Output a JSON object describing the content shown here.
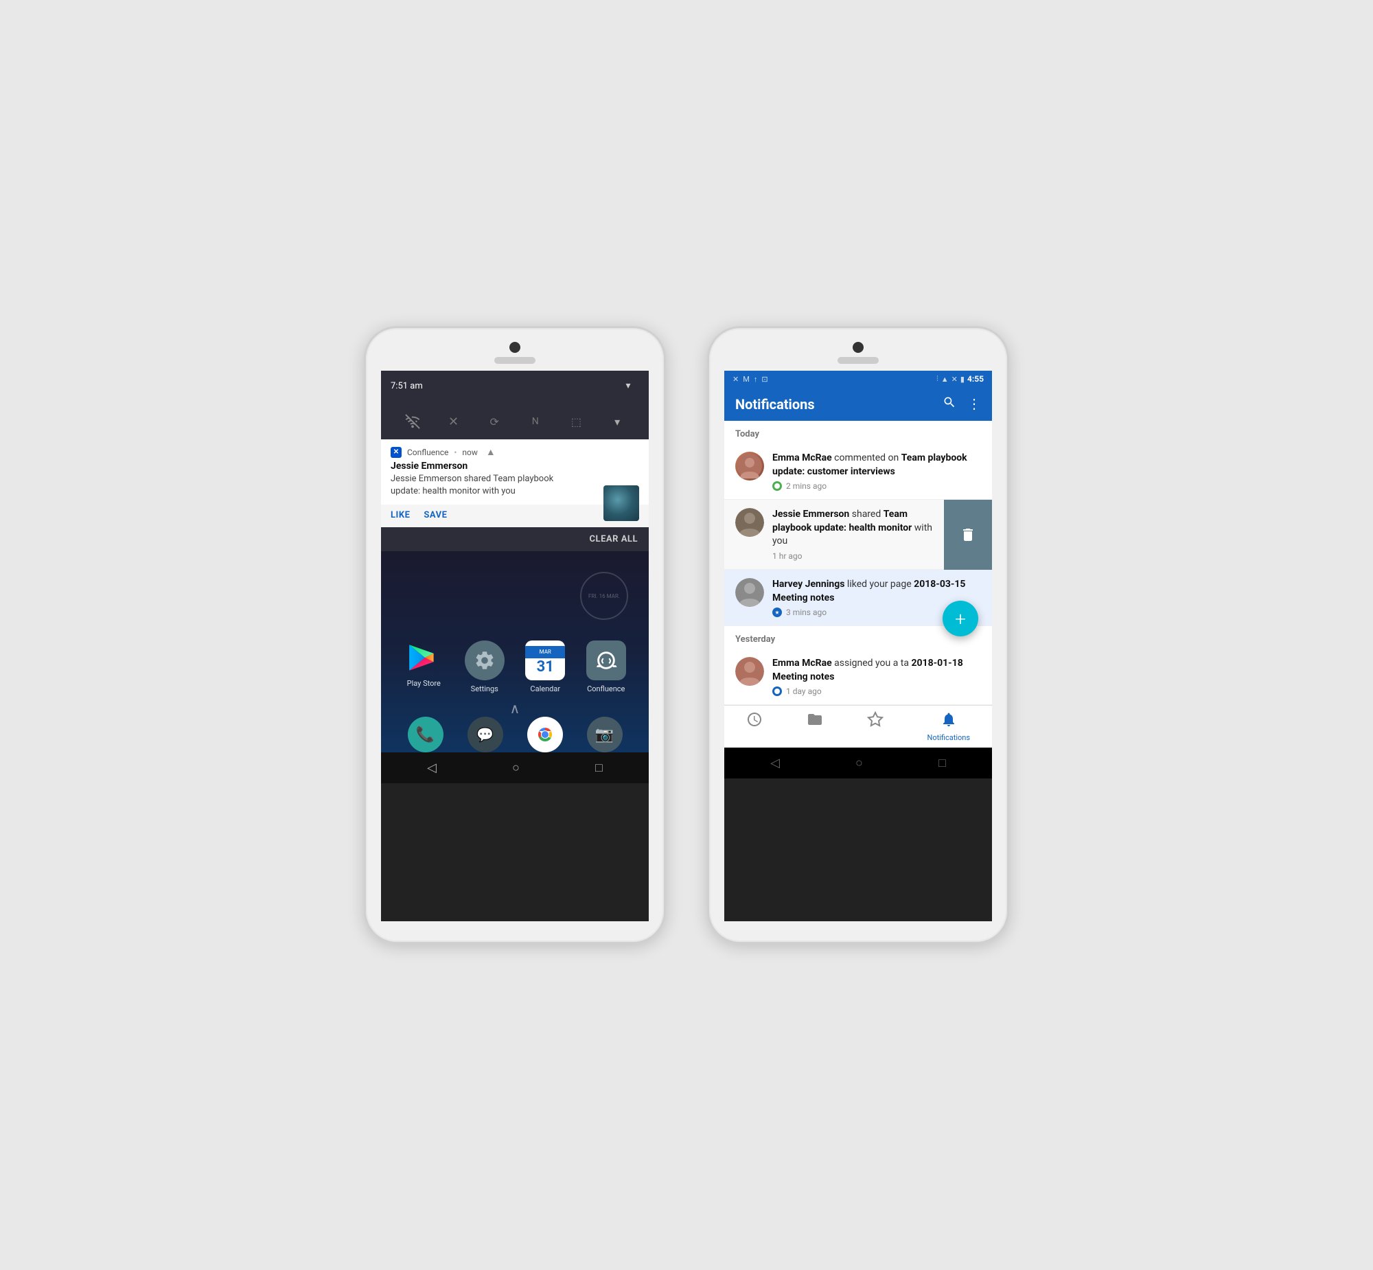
{
  "left_phone": {
    "status_bar": {
      "time": "7:51 am"
    },
    "notification": {
      "app_name": "Confluence",
      "time": "now",
      "title": "Jessie Emmerson",
      "body": "Jessie Emmerson shared Team playbook update: health monitor with you",
      "action1": "LIKE",
      "action2": "SAVE",
      "clear_all": "CLEAR ALL"
    },
    "home": {
      "clock": "FRI. 16 MAR.",
      "apps": [
        {
          "label": "Play Store",
          "icon": "playstore"
        },
        {
          "label": "Settings",
          "icon": "settings"
        },
        {
          "label": "Calendar",
          "icon": "calendar"
        },
        {
          "label": "Confluence",
          "icon": "confluence"
        }
      ],
      "dock": [
        {
          "label": "Phone",
          "icon": "phone"
        },
        {
          "label": "Messages",
          "icon": "messages"
        },
        {
          "label": "Chrome",
          "icon": "chrome"
        },
        {
          "label": "Camera",
          "icon": "camera"
        }
      ]
    },
    "nav": {
      "back": "◁",
      "home": "○",
      "recents": "□"
    }
  },
  "right_phone": {
    "status_bar": {
      "time": "4:55"
    },
    "app_bar": {
      "title": "Notifications",
      "search_label": "Search",
      "menu_label": "More options"
    },
    "sections": {
      "today": "Today",
      "yesterday": "Yesterday"
    },
    "notifications": [
      {
        "user": "Emma McRae",
        "action": "commented on",
        "page": "Team playbook update: customer interviews",
        "time": "2 mins ago",
        "dot_color": "green",
        "avatar": "emma"
      },
      {
        "user": "Jessie Emmerson",
        "action": "shared",
        "page": "Team playbook update: health monitor",
        "suffix": "with you",
        "time": "1 hr ago",
        "avatar": "jessie",
        "swiped": true
      },
      {
        "user": "Harvey Jennings",
        "action": "liked your page",
        "page": "2018-03-15 Meeting notes",
        "time": "3 mins ago",
        "dot_color": "blue",
        "avatar": "harvey"
      },
      {
        "user": "Emma McRae",
        "action": "assigned you a ta",
        "page": "2018-01-18 Meeting notes",
        "time": "1 day ago",
        "dot_color": "blue",
        "avatar": "emma2"
      }
    ],
    "bottom_nav": [
      {
        "label": "",
        "icon": "clock",
        "active": false
      },
      {
        "label": "",
        "icon": "folder",
        "active": false
      },
      {
        "label": "",
        "icon": "star",
        "active": false
      },
      {
        "label": "Notifications",
        "icon": "bell",
        "active": true
      }
    ],
    "fab": "+",
    "nav": {
      "back": "◁",
      "home": "○",
      "recents": "□"
    }
  }
}
